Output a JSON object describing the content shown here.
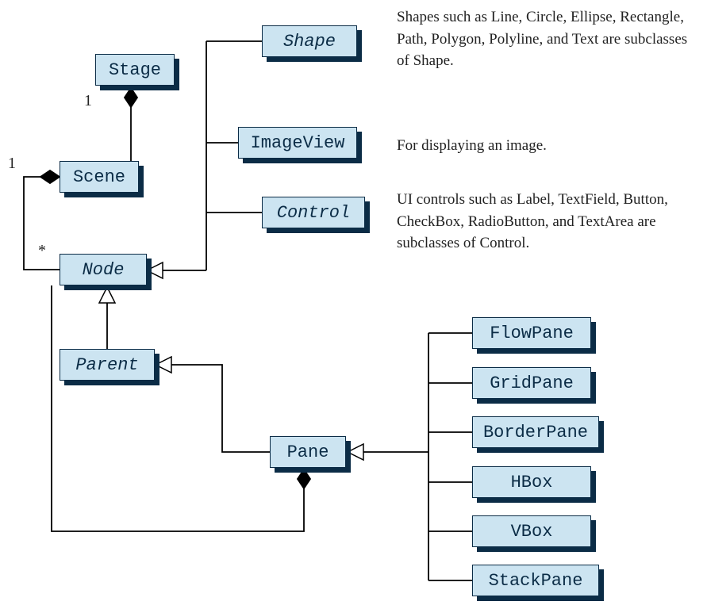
{
  "boxes": {
    "stage": {
      "label": "Stage",
      "italic": false
    },
    "scene": {
      "label": "Scene",
      "italic": false
    },
    "node": {
      "label": "Node",
      "italic": true
    },
    "parent": {
      "label": "Parent",
      "italic": true
    },
    "shape": {
      "label": "Shape",
      "italic": true
    },
    "imageview": {
      "label": "ImageView",
      "italic": false
    },
    "control": {
      "label": "Control",
      "italic": true
    },
    "pane": {
      "label": "Pane",
      "italic": false
    },
    "flowpane": {
      "label": "FlowPane",
      "italic": false
    },
    "gridpane": {
      "label": "GridPane",
      "italic": false
    },
    "borderpane": {
      "label": "BorderPane",
      "italic": false
    },
    "hbox": {
      "label": "HBox",
      "italic": false
    },
    "vbox": {
      "label": "VBox",
      "italic": false
    },
    "stackpane": {
      "label": "StackPane",
      "italic": false
    }
  },
  "descriptions": {
    "shape": "Shapes such as Line, Circle, Ellipse, Rectangle, Path, Polygon, Polyline, and Text are subclasses of Shape.",
    "imageview": "For displaying an image.",
    "control": "UI controls such as Label, TextField, Button, CheckBox, RadioButton, and TextArea are subclasses of Control."
  },
  "multiplicities": {
    "stage_scene": "1",
    "scene_node": "1",
    "pane_node": "*"
  },
  "chart_data": {
    "type": "uml-class-diagram",
    "classes": [
      {
        "name": "Stage",
        "abstract": false
      },
      {
        "name": "Scene",
        "abstract": false
      },
      {
        "name": "Node",
        "abstract": true
      },
      {
        "name": "Parent",
        "abstract": true
      },
      {
        "name": "Shape",
        "abstract": true
      },
      {
        "name": "ImageView",
        "abstract": false
      },
      {
        "name": "Control",
        "abstract": true
      },
      {
        "name": "Pane",
        "abstract": false
      },
      {
        "name": "FlowPane",
        "abstract": false
      },
      {
        "name": "GridPane",
        "abstract": false
      },
      {
        "name": "BorderPane",
        "abstract": false
      },
      {
        "name": "HBox",
        "abstract": false
      },
      {
        "name": "VBox",
        "abstract": false
      },
      {
        "name": "StackPane",
        "abstract": false
      }
    ],
    "inheritance": [
      {
        "child": "Shape",
        "parent": "Node"
      },
      {
        "child": "ImageView",
        "parent": "Node"
      },
      {
        "child": "Control",
        "parent": "Node"
      },
      {
        "child": "Parent",
        "parent": "Node"
      },
      {
        "child": "Pane",
        "parent": "Parent"
      },
      {
        "child": "FlowPane",
        "parent": "Pane"
      },
      {
        "child": "GridPane",
        "parent": "Pane"
      },
      {
        "child": "BorderPane",
        "parent": "Pane"
      },
      {
        "child": "HBox",
        "parent": "Pane"
      },
      {
        "child": "VBox",
        "parent": "Pane"
      },
      {
        "child": "StackPane",
        "parent": "Pane"
      }
    ],
    "composition": [
      {
        "whole": "Stage",
        "part": "Scene",
        "whole_mult": "1"
      },
      {
        "whole": "Scene",
        "part": "Node",
        "whole_mult": "1",
        "part_mult": "*"
      },
      {
        "whole": "Pane",
        "part": "Node",
        "part_mult": "*"
      }
    ]
  }
}
